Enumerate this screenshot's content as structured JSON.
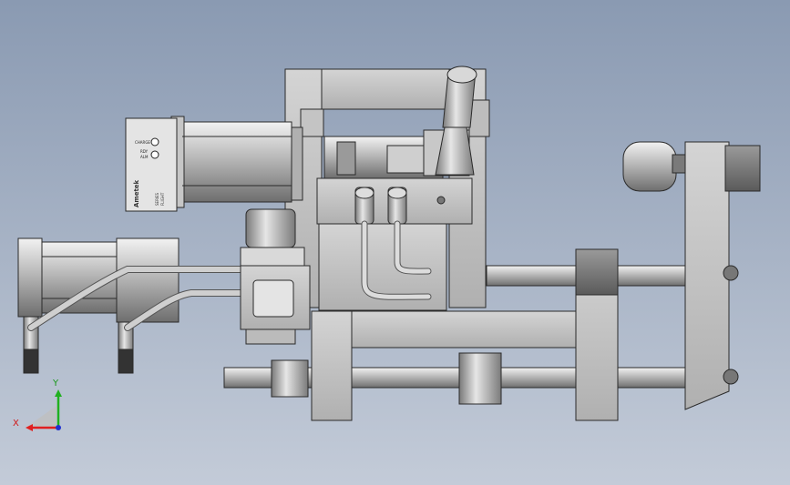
{
  "view": {
    "background_top": "#8a9ab2",
    "background_bottom": "#c3cbd8"
  },
  "motor_label": {
    "line1": "CHARGE",
    "line2": "RDY",
    "line3": "ALM",
    "brand": "Ametek",
    "series1": "SERIES",
    "series2": "FLIGHT"
  },
  "axis_triad": {
    "x_label": "X",
    "y_label": "Y",
    "x_color": "#e02020",
    "y_color": "#20b020",
    "z_color": "#2030d0"
  }
}
